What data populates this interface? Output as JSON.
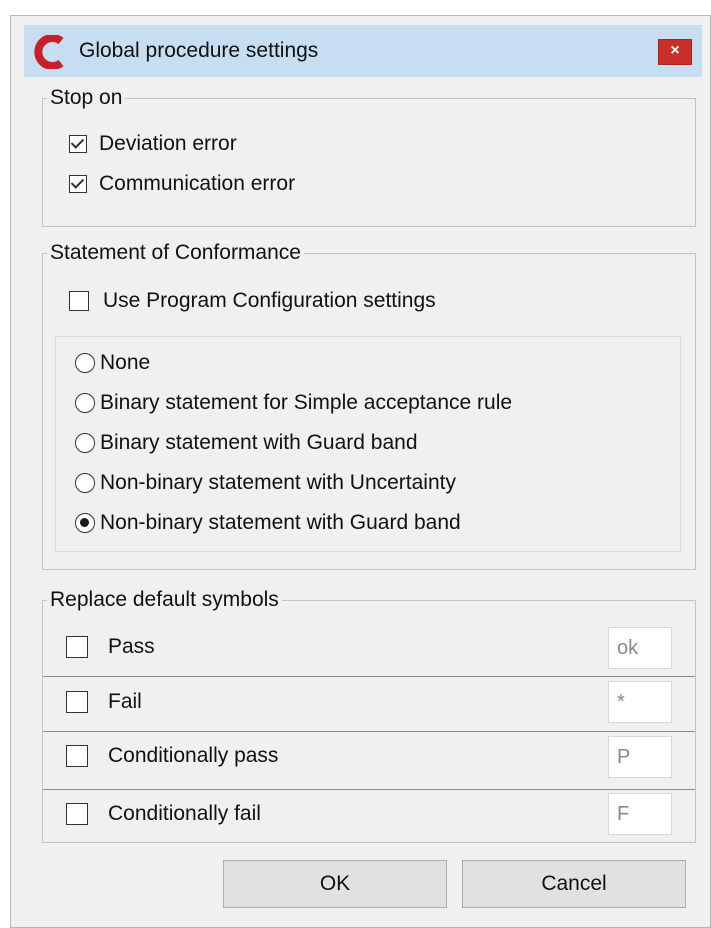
{
  "window": {
    "title": "Global procedure settings",
    "close_glyph": "×"
  },
  "stop_on": {
    "legend": "Stop on",
    "items": [
      {
        "label": "Deviation error",
        "checked": true
      },
      {
        "label": "Communication error",
        "checked": true
      }
    ]
  },
  "conformance": {
    "legend": "Statement of Conformance",
    "use_program_label": "Use Program Configuration settings",
    "use_program_checked": false,
    "options": [
      {
        "label": "None",
        "selected": false
      },
      {
        "label": "Binary statement for Simple acceptance rule",
        "selected": false
      },
      {
        "label": "Binary statement with Guard band",
        "selected": false
      },
      {
        "label": "Non-binary statement with Uncertainty",
        "selected": false
      },
      {
        "label": "Non-binary statement with Guard band",
        "selected": true
      }
    ]
  },
  "symbols": {
    "legend": "Replace default symbols",
    "rows": [
      {
        "label": "Pass",
        "value": "ok",
        "checked": false
      },
      {
        "label": "Fail",
        "value": "*",
        "checked": false
      },
      {
        "label": "Conditionally pass",
        "value": "P",
        "checked": false
      },
      {
        "label": "Conditionally fail",
        "value": "F",
        "checked": false
      }
    ]
  },
  "buttons": {
    "ok": "OK",
    "cancel": "Cancel"
  },
  "colors": {
    "titlebar": "#c7ddf2",
    "close": "#c9302c",
    "logo": "#c8202a",
    "dialog_bg": "#f0f0f0"
  }
}
